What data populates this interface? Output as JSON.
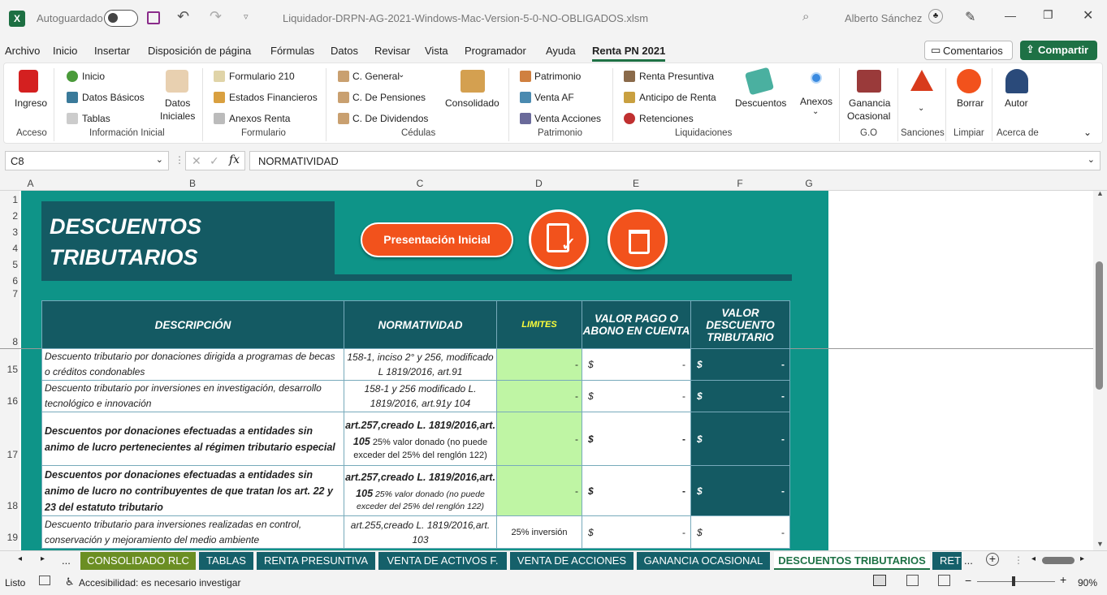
{
  "titlebar": {
    "autosave": "Autoguardado",
    "filename": "Liquidador-DRPN-AG-2021-Windows-Mac-Version-5-0-NO-OBLIGADOS.xlsm",
    "user": "Alberto Sánchez"
  },
  "menu": [
    "Archivo",
    "Inicio",
    "Insertar",
    "Disposición de página",
    "Fórmulas",
    "Datos",
    "Revisar",
    "Vista",
    "Programador",
    "Ayuda",
    "Renta PN 2021"
  ],
  "buttons": {
    "comments": "Comentarios",
    "share": "Compartir"
  },
  "ribbon": {
    "acceso": {
      "ingreso": "Ingreso",
      "group": "Acceso"
    },
    "info": {
      "inicio": "Inicio",
      "datos_basicos": "Datos Básicos",
      "tablas": "Tablas",
      "datos_iniciales_1": "Datos",
      "datos_iniciales_2": "Iniciales",
      "group": "Información Inicial"
    },
    "formulario": {
      "f210": "Formulario 210",
      "estados": "Estados Financieros",
      "anexos": "Anexos Renta",
      "group": "Formulario"
    },
    "cedulas": {
      "general": "C. General",
      "pensiones": "C. De Pensiones",
      "dividendos": "C. De Dividendos",
      "consolidado": "Consolidado",
      "group": "Cédulas"
    },
    "patrimonio": {
      "patrimonio": "Patrimonio",
      "venta_af": "Venta AF",
      "venta_acciones": "Venta Acciones",
      "group": "Patrimonio"
    },
    "liquidaciones": {
      "presuntiva": "Renta Presuntiva",
      "anticipo": "Anticipo de Renta",
      "retenciones": "Retenciones",
      "descuentos": "Descuentos",
      "anexos": "Anexos",
      "group": "Liquidaciones"
    },
    "go": {
      "ganancia_1": "Ganancia",
      "ganancia_2": "Ocasional",
      "group": "G.O"
    },
    "sanciones": {
      "group": "Sanciones"
    },
    "limpiar": {
      "borrar": "Borrar",
      "group": "Limpiar"
    },
    "acerca": {
      "autor": "Autor",
      "group": "Acerca de"
    }
  },
  "formula": {
    "cell": "C8",
    "content": "NORMATIVIDAD"
  },
  "columns": [
    "A",
    "B",
    "C",
    "D",
    "E",
    "F",
    "G"
  ],
  "rows": [
    "1",
    "2",
    "3",
    "4",
    "5",
    "6",
    "7",
    "8",
    "15",
    "16",
    "17",
    "18",
    "19"
  ],
  "sheet": {
    "title_1": "DESCUENTOS",
    "title_2": "TRIBUTARIOS",
    "btn_presentacion": "Presentación Inicial",
    "headers": {
      "desc": "DESCRIPCIÓN",
      "norm": "NORMATIVIDAD",
      "lim": "LIMITES",
      "pago": "VALOR PAGO O ABONO EN CUENTA",
      "valor": "VALOR DESCUENTO TRIBUTARIO"
    },
    "table": [
      {
        "desc": "Descuento tributario por donaciones dirigida a programas de becas o créditos condonables",
        "norm": "158-1, inciso 2° y 256, modificado L 1819/2016, art.91",
        "lim": "-",
        "dol": "$",
        "pay": "-",
        "val": "-"
      },
      {
        "desc": "Descuento tributario por inversiones en investigación, desarrollo tecnológico e innovación",
        "norm": "158-1 y 256 modificado L. 1819/2016, art.91y 104",
        "lim": "-",
        "dol": "$",
        "pay": "-",
        "val": "-"
      },
      {
        "desc": "Descuentos  por donaciones efectuadas a entidades sin animo de lucro pertenecientes al régimen tributario especial",
        "norm_b": "art.257,creado L. 1819/2016,art. 105",
        "norm": "25% valor donado (no puede exceder del 25% del renglón 122)",
        "lim": "-",
        "dol": "$",
        "pay": "-",
        "val": "-"
      },
      {
        "desc": "Descuentos por donaciones efectuadas a entidades sin animo de lucro no contribuyentes de que tratan los art. 22 y 23 del estatuto tributario",
        "norm_b": "art.257,creado L. 1819/2016,art. 105",
        "norm": "25% valor donado (no puede exceder del 25% del renglón 122)",
        "lim": "-",
        "dol": "$",
        "pay": "-",
        "val": "-"
      },
      {
        "desc": "Descuento tributario para inversiones realizadas en control, conservación y mejoramiento del medio ambiente",
        "norm": "art.255,creado L. 1819/2016,art. 103",
        "lim": "25% inversión",
        "dol": "$",
        "pay": "-",
        "val": "-"
      }
    ]
  },
  "tabs": [
    "...",
    "CONSOLIDADO RLC",
    "TABLAS",
    "RENTA PRESUNTIVA",
    "VENTA DE ACTIVOS F.",
    "VENTA DE ACCIONES",
    "GANANCIA OCASIONAL",
    "DESCUENTOS TRIBUTARIOS",
    "RETE",
    "..."
  ],
  "status": {
    "ready": "Listo",
    "accessibility": "Accesibilidad: es necesario investigar",
    "zoom": "90%"
  },
  "colors": {
    "teal": "#0e9488",
    "dark": "#145a63",
    "orange": "#f2521c",
    "green": "#1e7145"
  }
}
